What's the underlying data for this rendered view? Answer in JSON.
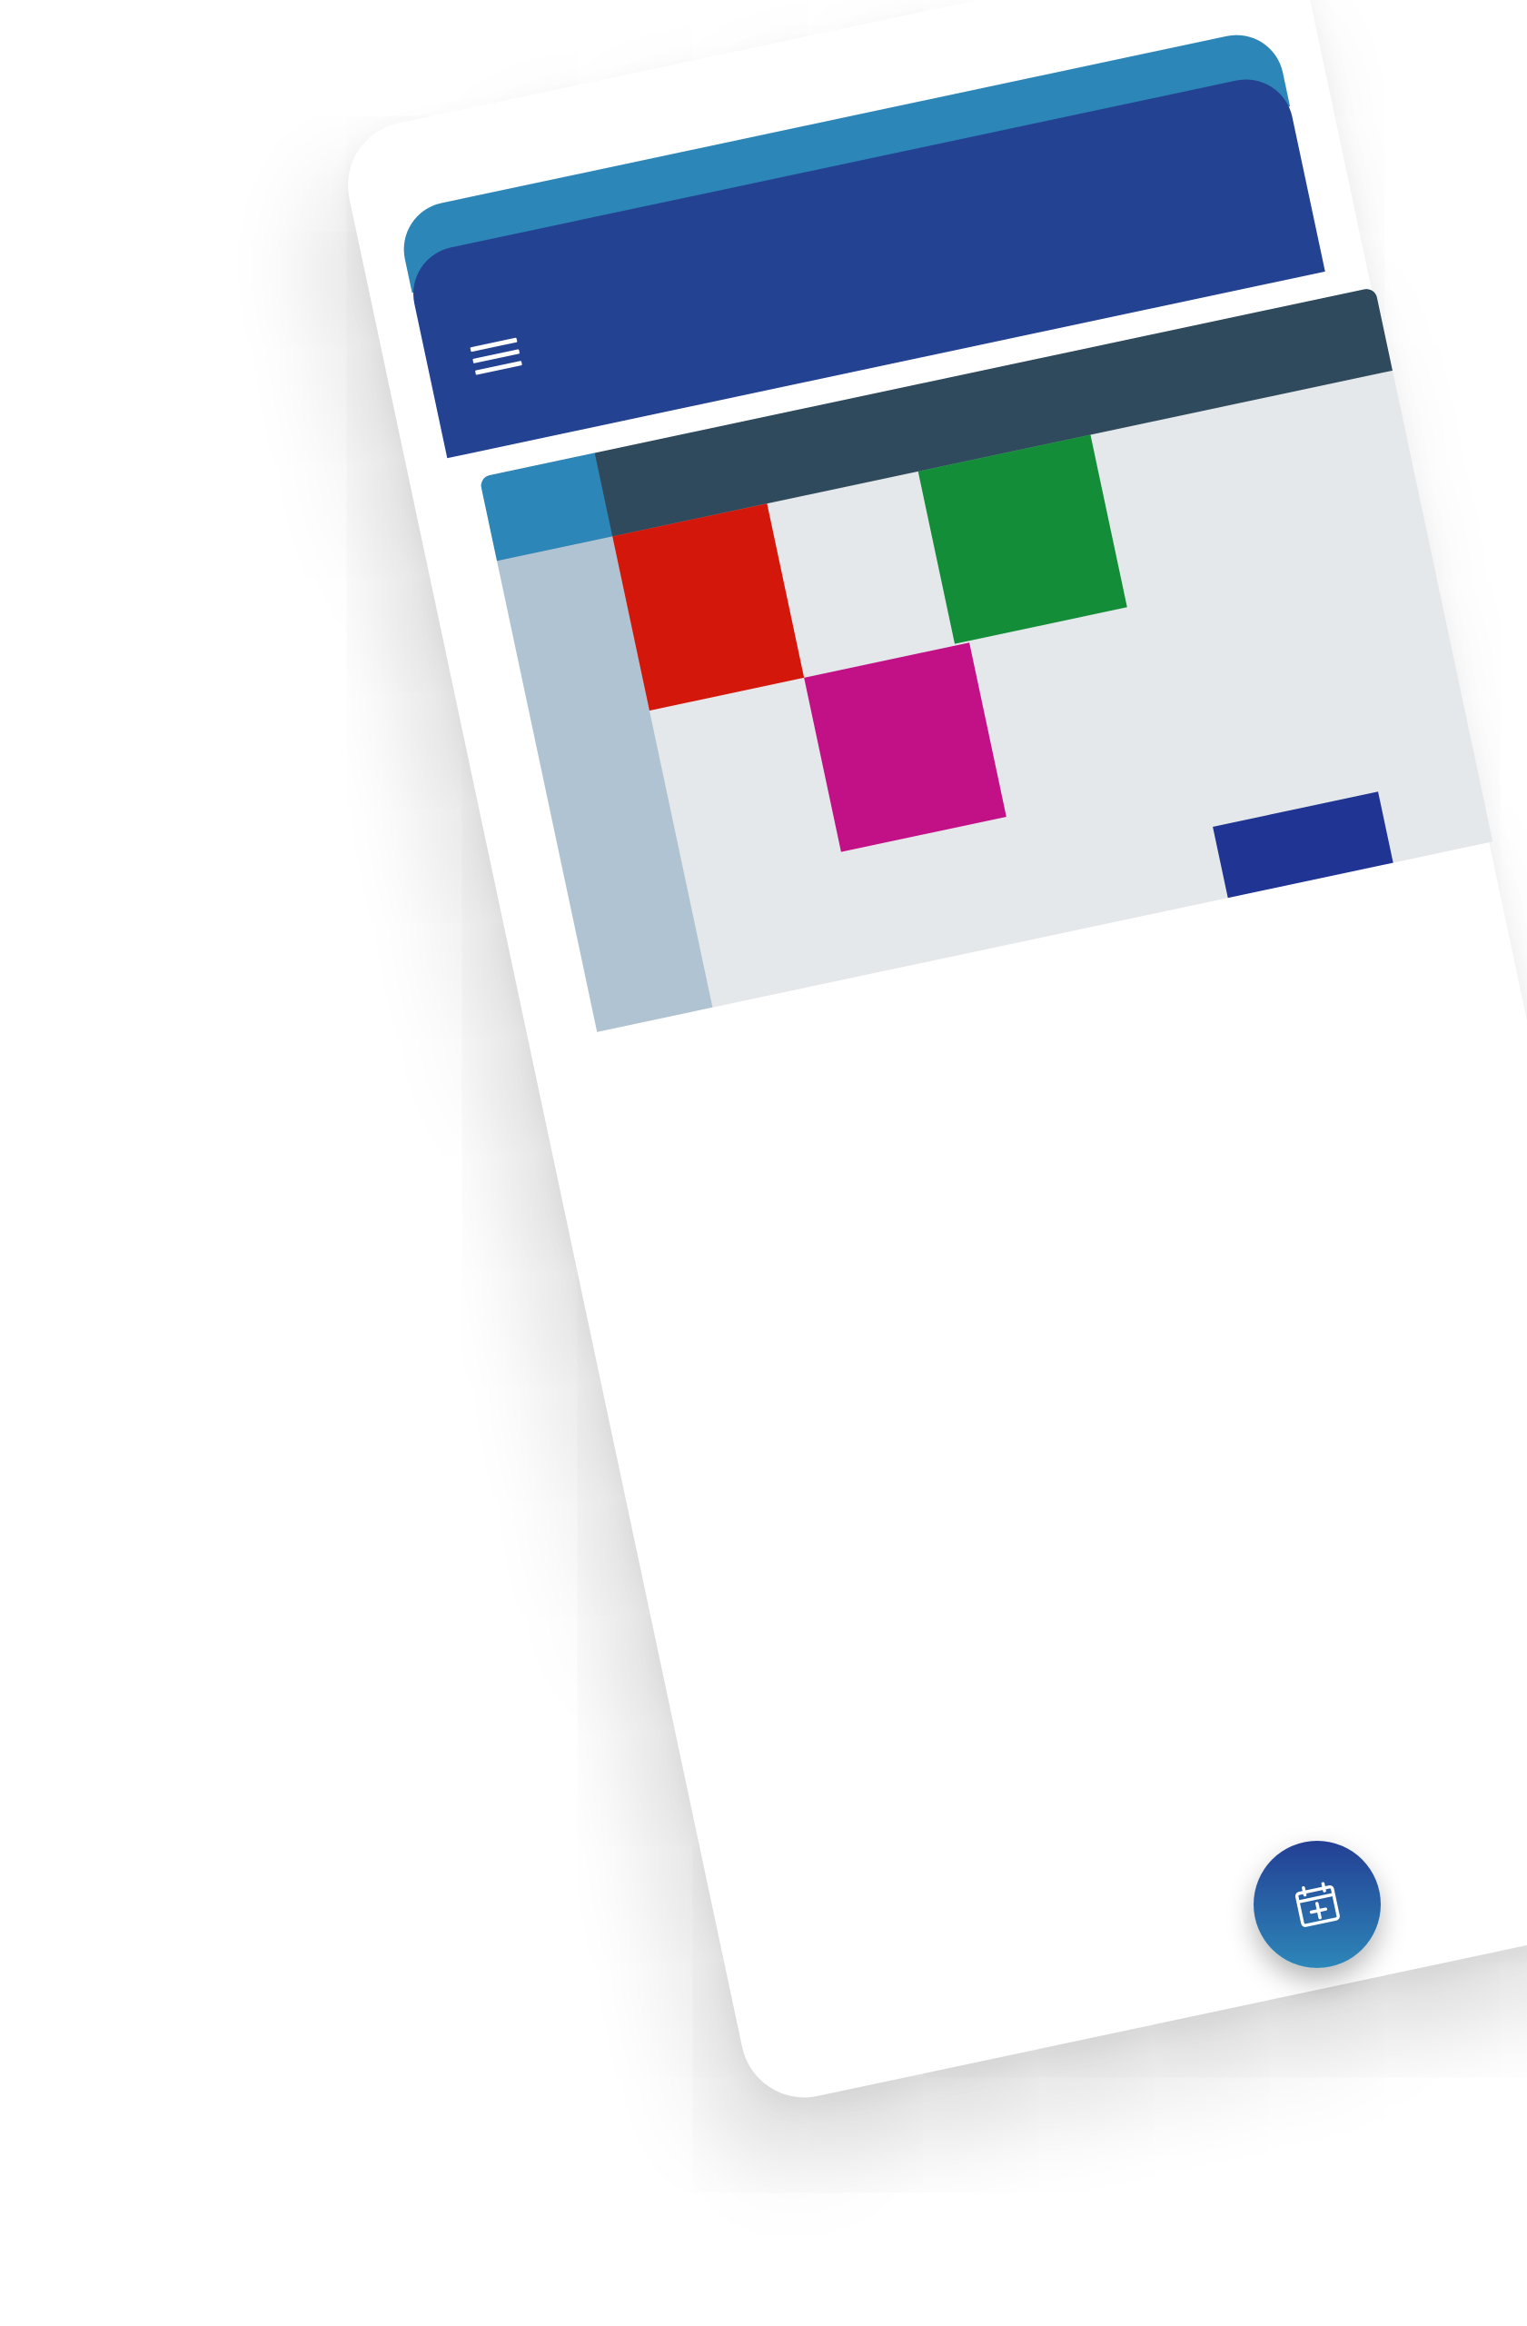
{
  "app": {
    "header": {
      "menu_icon": "hamburger-menu-icon",
      "colors": {
        "primary": "#244292",
        "accent": "#2d86b8"
      }
    },
    "calendar": {
      "colors": {
        "topbar": "#2f4a5c",
        "corner": "#2d86b8",
        "sidebar": "#afc3d3",
        "grid_background": "#e4e8ea"
      },
      "events": [
        {
          "color": "#d3170a",
          "name": "event-red"
        },
        {
          "color": "#138d37",
          "name": "event-green"
        },
        {
          "color": "#c21086",
          "name": "event-magenta"
        },
        {
          "color": "#1f3493",
          "name": "event-blue"
        }
      ]
    },
    "fab": {
      "icon": "calendar-add-icon",
      "colors": {
        "from": "#233f94",
        "to": "#2d86b8"
      }
    }
  }
}
